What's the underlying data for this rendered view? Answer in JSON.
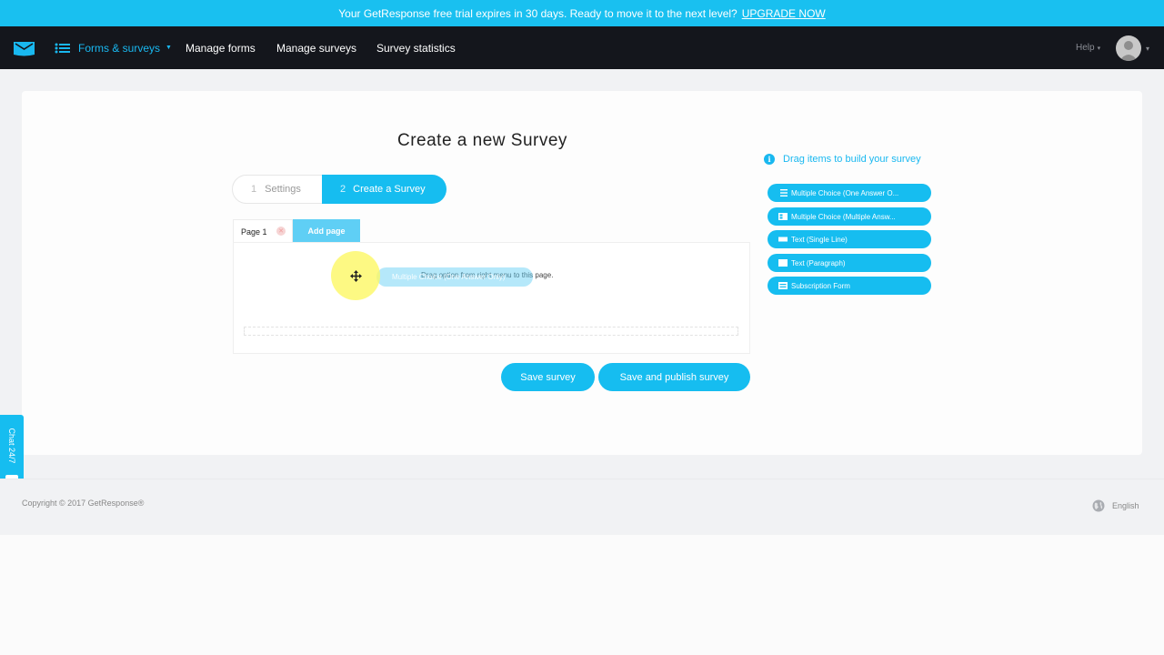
{
  "trial_banner": {
    "text": "Your GetResponse free trial expires in 30 days. Ready to move it to the next level?",
    "link": "UPGRADE NOW"
  },
  "nav": {
    "active_section": "Forms & surveys",
    "links": [
      "Manage forms",
      "Manage surveys",
      "Survey statistics"
    ],
    "help": "Help"
  },
  "page": {
    "title": "Create a new Survey",
    "steps": [
      {
        "num": "1",
        "label": "Settings"
      },
      {
        "num": "2",
        "label": "Create a Survey"
      }
    ],
    "tabs": {
      "page1": "Page 1",
      "add": "Add page"
    },
    "drop_hint": "Drag option from right menu to this page.",
    "dragging_item": "Multiple Choice (One Answer Only)",
    "buttons": {
      "save": "Save survey",
      "publish": "Save and publish survey"
    }
  },
  "palette": {
    "hint": "Drag items to build your survey",
    "items": [
      "Multiple Choice (One Answer O...",
      "Multiple Choice (Multiple Answ...",
      "Text (Single Line)",
      "Text (Paragraph)",
      "Subscription Form"
    ]
  },
  "chat": {
    "label": "Chat 24/7"
  },
  "footer": {
    "copyright": "Copyright © 2017 GetResponse®",
    "language": "English"
  },
  "colors": {
    "accent": "#16bdf0",
    "topbar": "#14161c",
    "banner": "#19c0f0"
  }
}
